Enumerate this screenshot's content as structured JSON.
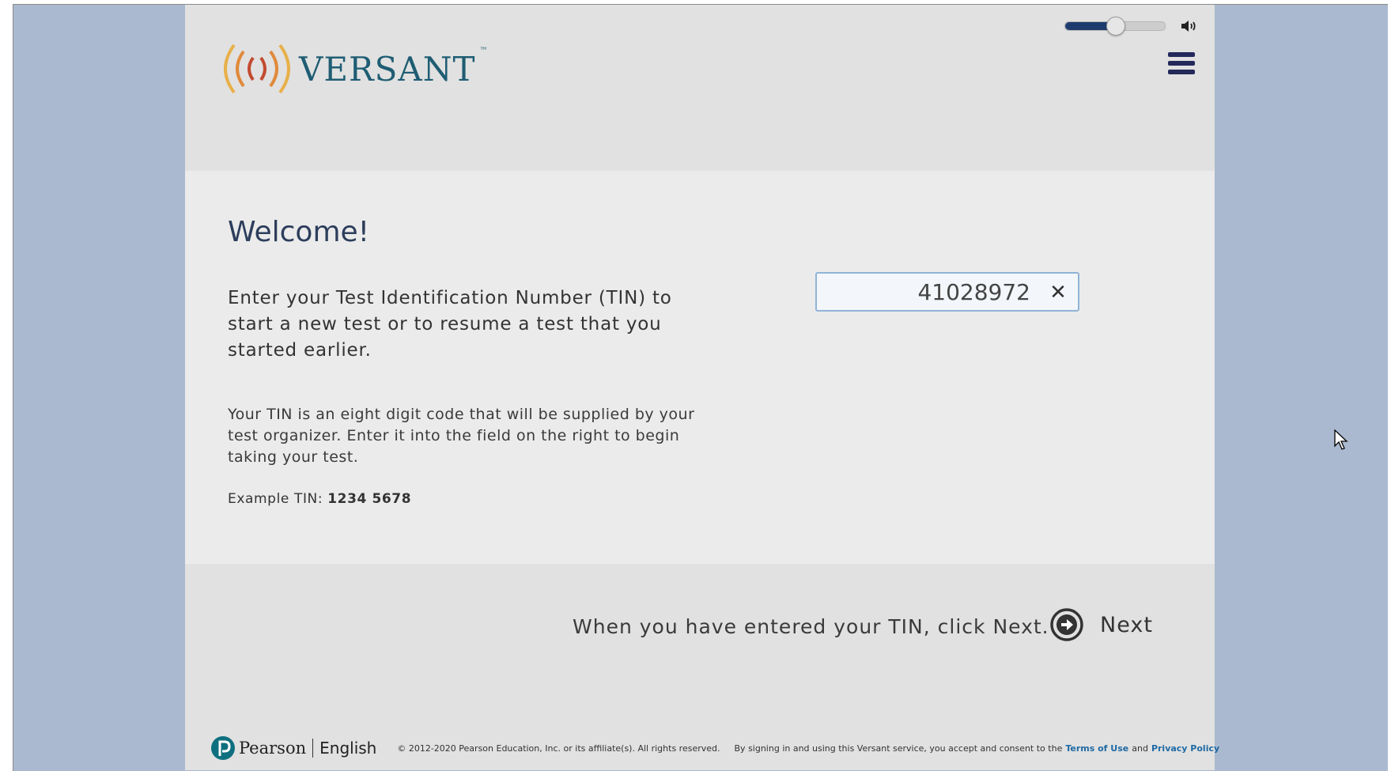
{
  "header": {
    "logo_text": "VERSANT",
    "logo_tm": "™",
    "volume": {
      "level": 0.5
    }
  },
  "main": {
    "title": "Welcome!",
    "intro": "Enter your Test Identification Number (TIN) to start a new test or to resume a test that you started earlier.",
    "help": "Your TIN is an eight digit code that will be supplied by your test organizer. Enter it into the field on the right to begin taking your test.",
    "example_label": "Example TIN:",
    "example_value": "1234 5678",
    "tin_input": {
      "value": "41028972",
      "clear_symbol": "✕"
    }
  },
  "footer": {
    "instruction": "When you have entered your TIN, click Next.",
    "next_label": "Next",
    "brand_pearson": "Pearson",
    "brand_english": "English",
    "copyright": "© 2012-2020 Pearson Education, Inc. or its affiliate(s). All rights reserved.",
    "consent": "By signing in and using this Versant service, you accept and consent to the",
    "terms_link": "Terms of Use",
    "and_text": "and",
    "privacy_link": "Privacy Policy"
  },
  "colors": {
    "outer_background": "#aab9cf",
    "accent_navy": "#24295a",
    "link_blue": "#1f6aa4",
    "logo_teal": "#1f5d73"
  }
}
